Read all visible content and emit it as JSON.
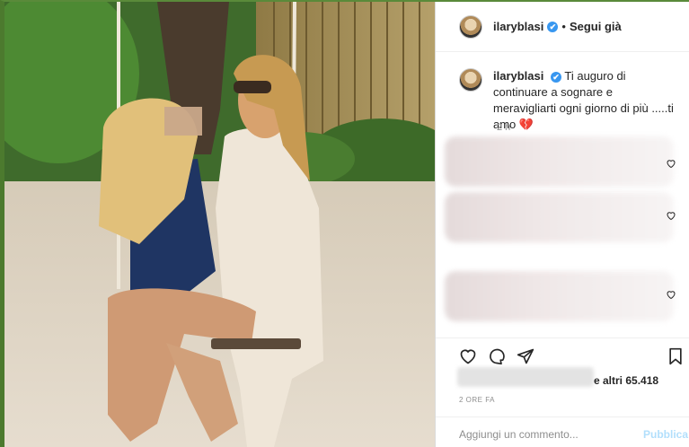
{
  "post": {
    "username": "ilaryblasi",
    "verified_mark": "✔",
    "separator": "•",
    "follow_label": "Segui già",
    "caption_user": "ilaryblasi",
    "caption_text": "Ti auguro di continuare a sognare e meravigliarti ogni giorno di più .....ti amo",
    "caption_emoji": "💔",
    "caption_time": "2 h",
    "likes_suffix": "e altri 65.418",
    "time_ago": "2 ORE FA",
    "comment_placeholder": "Aggiungi un commento...",
    "publish_label": "Pubblica"
  },
  "icons": {
    "like": "heart-icon",
    "comment": "comment-icon",
    "share": "share-icon",
    "save": "bookmark-icon"
  },
  "colors": {
    "verified": "#3897f0",
    "publish": "#b2dffc",
    "secondary_text": "#8e8e8e"
  }
}
